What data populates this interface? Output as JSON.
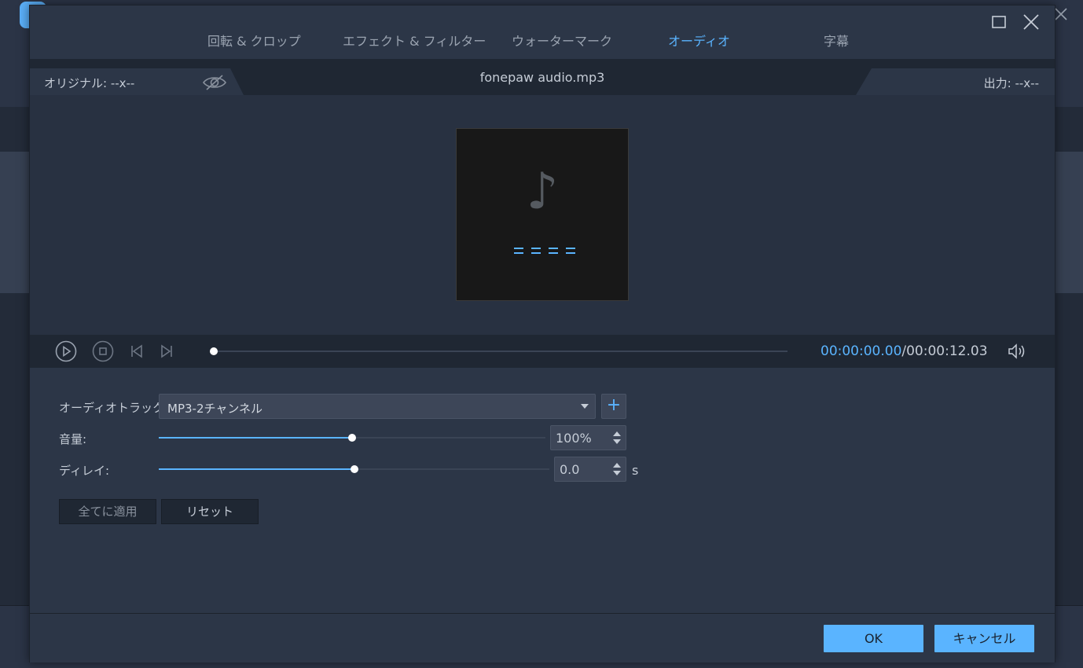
{
  "tabs": [
    {
      "label": "回転 & クロップ",
      "active": false
    },
    {
      "label": "エフェクト & フィルター",
      "active": false
    },
    {
      "label": "ウォーターマーク",
      "active": false
    },
    {
      "label": "オーディオ",
      "active": true
    },
    {
      "label": "字幕",
      "active": false
    }
  ],
  "info": {
    "original": "オリジナル: --x--",
    "filename": "fonepaw audio.mp3",
    "output": "出力: --x--"
  },
  "player": {
    "current_time": "00:00:00.00",
    "total_time": "/00:00:12.03",
    "progress": 0.0
  },
  "audio": {
    "track_label": "オーディオトラック:",
    "track_value": "MP3-2チャンネル",
    "add_label": "+",
    "volume_label": "音量:",
    "volume_value": "100%",
    "volume_level": 0.5,
    "delay_label": "ディレイ:",
    "delay_value": "0.0",
    "delay_level": 0.5,
    "delay_unit": "s",
    "apply_all_label": "全てに適用",
    "reset_label": "リセット"
  },
  "footer": {
    "ok_label": "OK",
    "cancel_label": "キャンセル"
  },
  "colors": {
    "accent": "#5ab4ff",
    "dialog_bg": "#2c3647",
    "dark_bar": "#1f2733"
  }
}
